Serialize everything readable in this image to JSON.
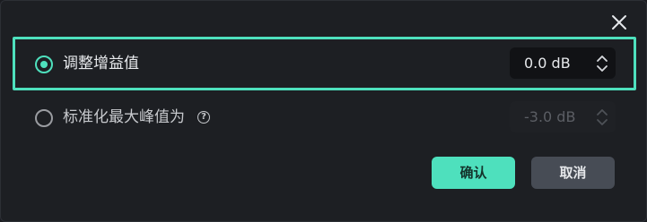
{
  "dialog": {
    "close_icon": "close-icon",
    "options": [
      {
        "label": "调整增益值",
        "selected": true,
        "value": "0.0 dB",
        "enabled": true
      },
      {
        "label": "标准化最大峰值为",
        "selected": false,
        "value": "-3.0 dB",
        "enabled": false,
        "help_icon": "help-circle-icon",
        "help_glyph": "?"
      }
    ],
    "buttons": {
      "confirm_label": "确认",
      "cancel_label": "取消"
    },
    "colors": {
      "accent": "#4ee0bd",
      "background": "#1d1f23",
      "cancel_button": "#474c55"
    }
  }
}
